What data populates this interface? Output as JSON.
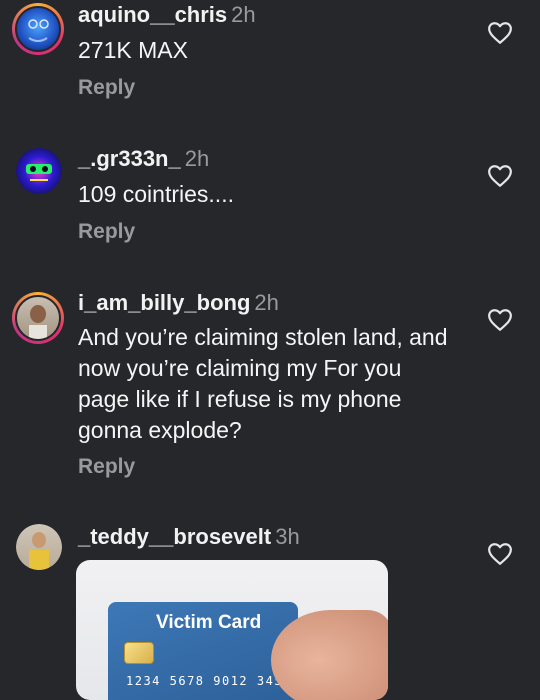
{
  "comments": [
    {
      "username": "aquino__chris",
      "time": "2h",
      "text": "271K MAX",
      "reply_label": "Reply"
    },
    {
      "username": "_.gr333n_",
      "time": "2h",
      "text": "109 cointries....",
      "reply_label": "Reply"
    },
    {
      "username": "i_am_billy_bong",
      "time": "2h",
      "text": "And you’re claiming stolen land, and now you’re claiming my For you page like if I refuse is my phone gonna explode?",
      "reply_label": "Reply"
    },
    {
      "username": "_teddy__brosevelt",
      "time": "3h"
    }
  ],
  "media": {
    "card_title": "Victim Card",
    "card_number": "1234 5678 9012 345"
  },
  "icons": {
    "like": "heart-outline-icon"
  },
  "colors": {
    "background": "#26272b",
    "muted": "#9a9a9e"
  }
}
